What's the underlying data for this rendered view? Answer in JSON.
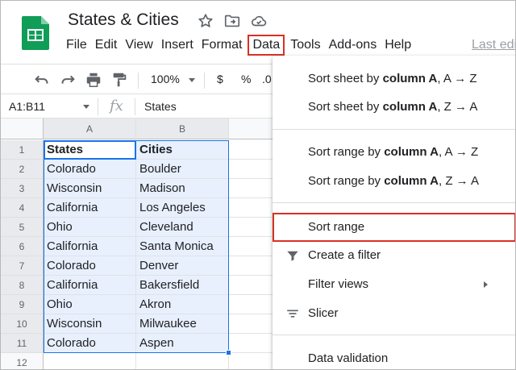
{
  "app": {
    "title": "States & Cities",
    "brand_color": "#0f9d58"
  },
  "menubar": {
    "items": [
      "File",
      "Edit",
      "View",
      "Insert",
      "Format",
      "Data",
      "Tools",
      "Add-ons",
      "Help"
    ],
    "active": "Data",
    "last_edit": "Last edi"
  },
  "toolbar": {
    "zoom": "100%",
    "currency": "$",
    "percent": "%",
    "decimal": ".0"
  },
  "formula_bar": {
    "name_box": "A1:B11",
    "fx": "fx",
    "value": "States"
  },
  "sheet": {
    "columns": [
      "A",
      "B"
    ],
    "rows": [
      "1",
      "2",
      "3",
      "4",
      "5",
      "6",
      "7",
      "8",
      "9",
      "10",
      "11",
      "12"
    ],
    "cells": [
      [
        "States",
        "Cities"
      ],
      [
        "Colorado",
        "Boulder"
      ],
      [
        "Wisconsin",
        "Madison"
      ],
      [
        "California",
        "Los Angeles"
      ],
      [
        "Ohio",
        "Cleveland"
      ],
      [
        "California",
        "Santa Monica"
      ],
      [
        "Colorado",
        "Denver"
      ],
      [
        "California",
        "Bakersfield"
      ],
      [
        "Ohio",
        "Akron"
      ],
      [
        "Wisconsin",
        "Milwaukee"
      ],
      [
        "Colorado",
        "Aspen"
      ]
    ],
    "selection": "A1:B11",
    "selection_color": "#1a73e8"
  },
  "data_menu": {
    "sort_sheet_prefix": "Sort sheet by ",
    "sort_range_prefix": "Sort range by ",
    "column_label": "column A",
    "az_suffix": ", A → Z",
    "za_suffix": ", Z → A",
    "sort_range": "Sort range",
    "create_filter": "Create a filter",
    "filter_views": "Filter views",
    "slicer": "Slicer",
    "data_validation": "Data validation",
    "highlight_color": "#d93025"
  }
}
